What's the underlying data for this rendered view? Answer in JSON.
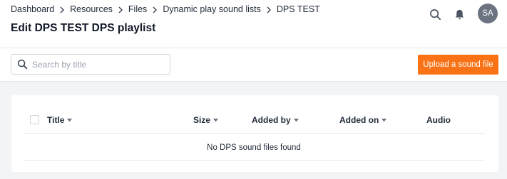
{
  "header": {
    "breadcrumb": [
      "Dashboard",
      "Resources",
      "Files",
      "Dynamic play sound lists",
      "DPS TEST"
    ],
    "title": "Edit DPS TEST DPS playlist",
    "avatar_initials": "SA",
    "icons": [
      "search-icon",
      "bell-icon"
    ]
  },
  "toolbar": {
    "search_placeholder": "Search by title",
    "search_value": "",
    "upload_label": "Upload a sound file"
  },
  "table": {
    "columns": [
      {
        "label": "Title",
        "sortable": true
      },
      {
        "label": "Size",
        "sortable": true
      },
      {
        "label": "Added by",
        "sortable": true
      },
      {
        "label": "Added on",
        "sortable": true
      },
      {
        "label": "Audio",
        "sortable": false
      }
    ],
    "empty_message": "No DPS sound files found"
  },
  "colors": {
    "accent": "#f97316",
    "background": "#f3f4f6",
    "avatar": "#6b7280"
  }
}
